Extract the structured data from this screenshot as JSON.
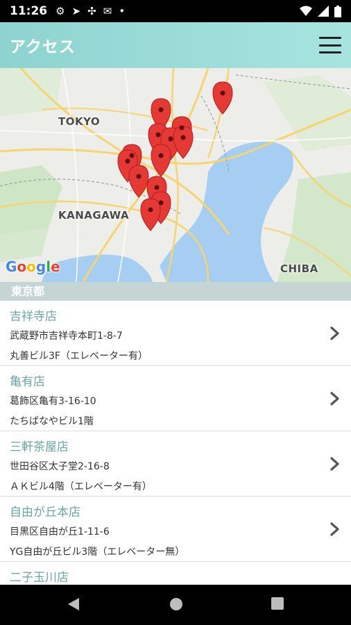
{
  "status": {
    "time": "11:26"
  },
  "header": {
    "title": "アクセス"
  },
  "map": {
    "labels": {
      "tokyo": "TOKYO",
      "kanagawa": "KANAGAWA",
      "chiba": "CHIBA"
    },
    "google": [
      "G",
      "o",
      "o",
      "g",
      "l",
      "e"
    ]
  },
  "section": {
    "label": "東京都"
  },
  "stores": [
    {
      "name": "吉祥寺店",
      "address": "武蔵野市吉祥寺本町1-8-7",
      "building": "丸善ビル3F（エレベーター有）"
    },
    {
      "name": "亀有店",
      "address": "葛飾区亀有3-16-10",
      "building": "たちばなやビル1階"
    },
    {
      "name": "三軒茶屋店",
      "address": "世田谷区太子堂2-16-8",
      "building": "ＡＫビル4階（エレベーター有）"
    },
    {
      "name": "自由が丘本店",
      "address": "目黒区自由が丘1-11-6",
      "building": "YG自由が丘ビル3階（エレベーター無）"
    },
    {
      "name": "二子玉川店",
      "address": "",
      "building": ""
    }
  ]
}
